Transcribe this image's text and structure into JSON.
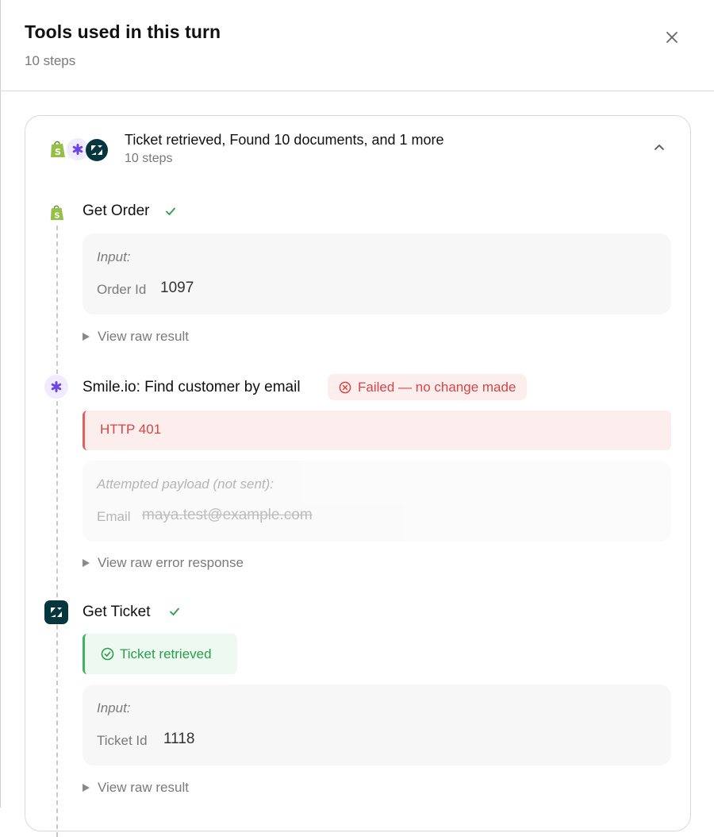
{
  "header": {
    "title": "Tools used in this turn",
    "subtitle": "10 steps"
  },
  "group": {
    "title": "Ticket retrieved, Found 10 documents, and 1 more",
    "subtitle": "10 steps",
    "icons": [
      "shopify-icon",
      "smile-io-icon",
      "zendesk-icon"
    ]
  },
  "steps": [
    {
      "icon": "shopify-icon",
      "title": "Get Order",
      "status": "success",
      "input_title": "Input:",
      "input_key": "Order Id",
      "input_value": "1097",
      "raw_link": "View raw result"
    },
    {
      "icon": "smile-io-icon",
      "title": "Smile.io: Find customer by email",
      "status": "failed",
      "badge": "Failed — no change made",
      "error": "HTTP 401",
      "payload_title": "Attempted payload (not sent):",
      "payload_key": "Email",
      "payload_value": "maya.test@example.com",
      "raw_link": "View raw error response"
    },
    {
      "icon": "zendesk-icon",
      "title": "Get Ticket",
      "status": "success",
      "result": "Ticket retrieved",
      "input_title": "Input:",
      "input_key": "Ticket Id",
      "input_value": "1118",
      "raw_link": "View raw result"
    }
  ],
  "colors": {
    "success": "#27a048",
    "error": "#d64545",
    "zendesk": "#03363d",
    "smile": "#6b46e5",
    "shopify": "#95bf47"
  }
}
